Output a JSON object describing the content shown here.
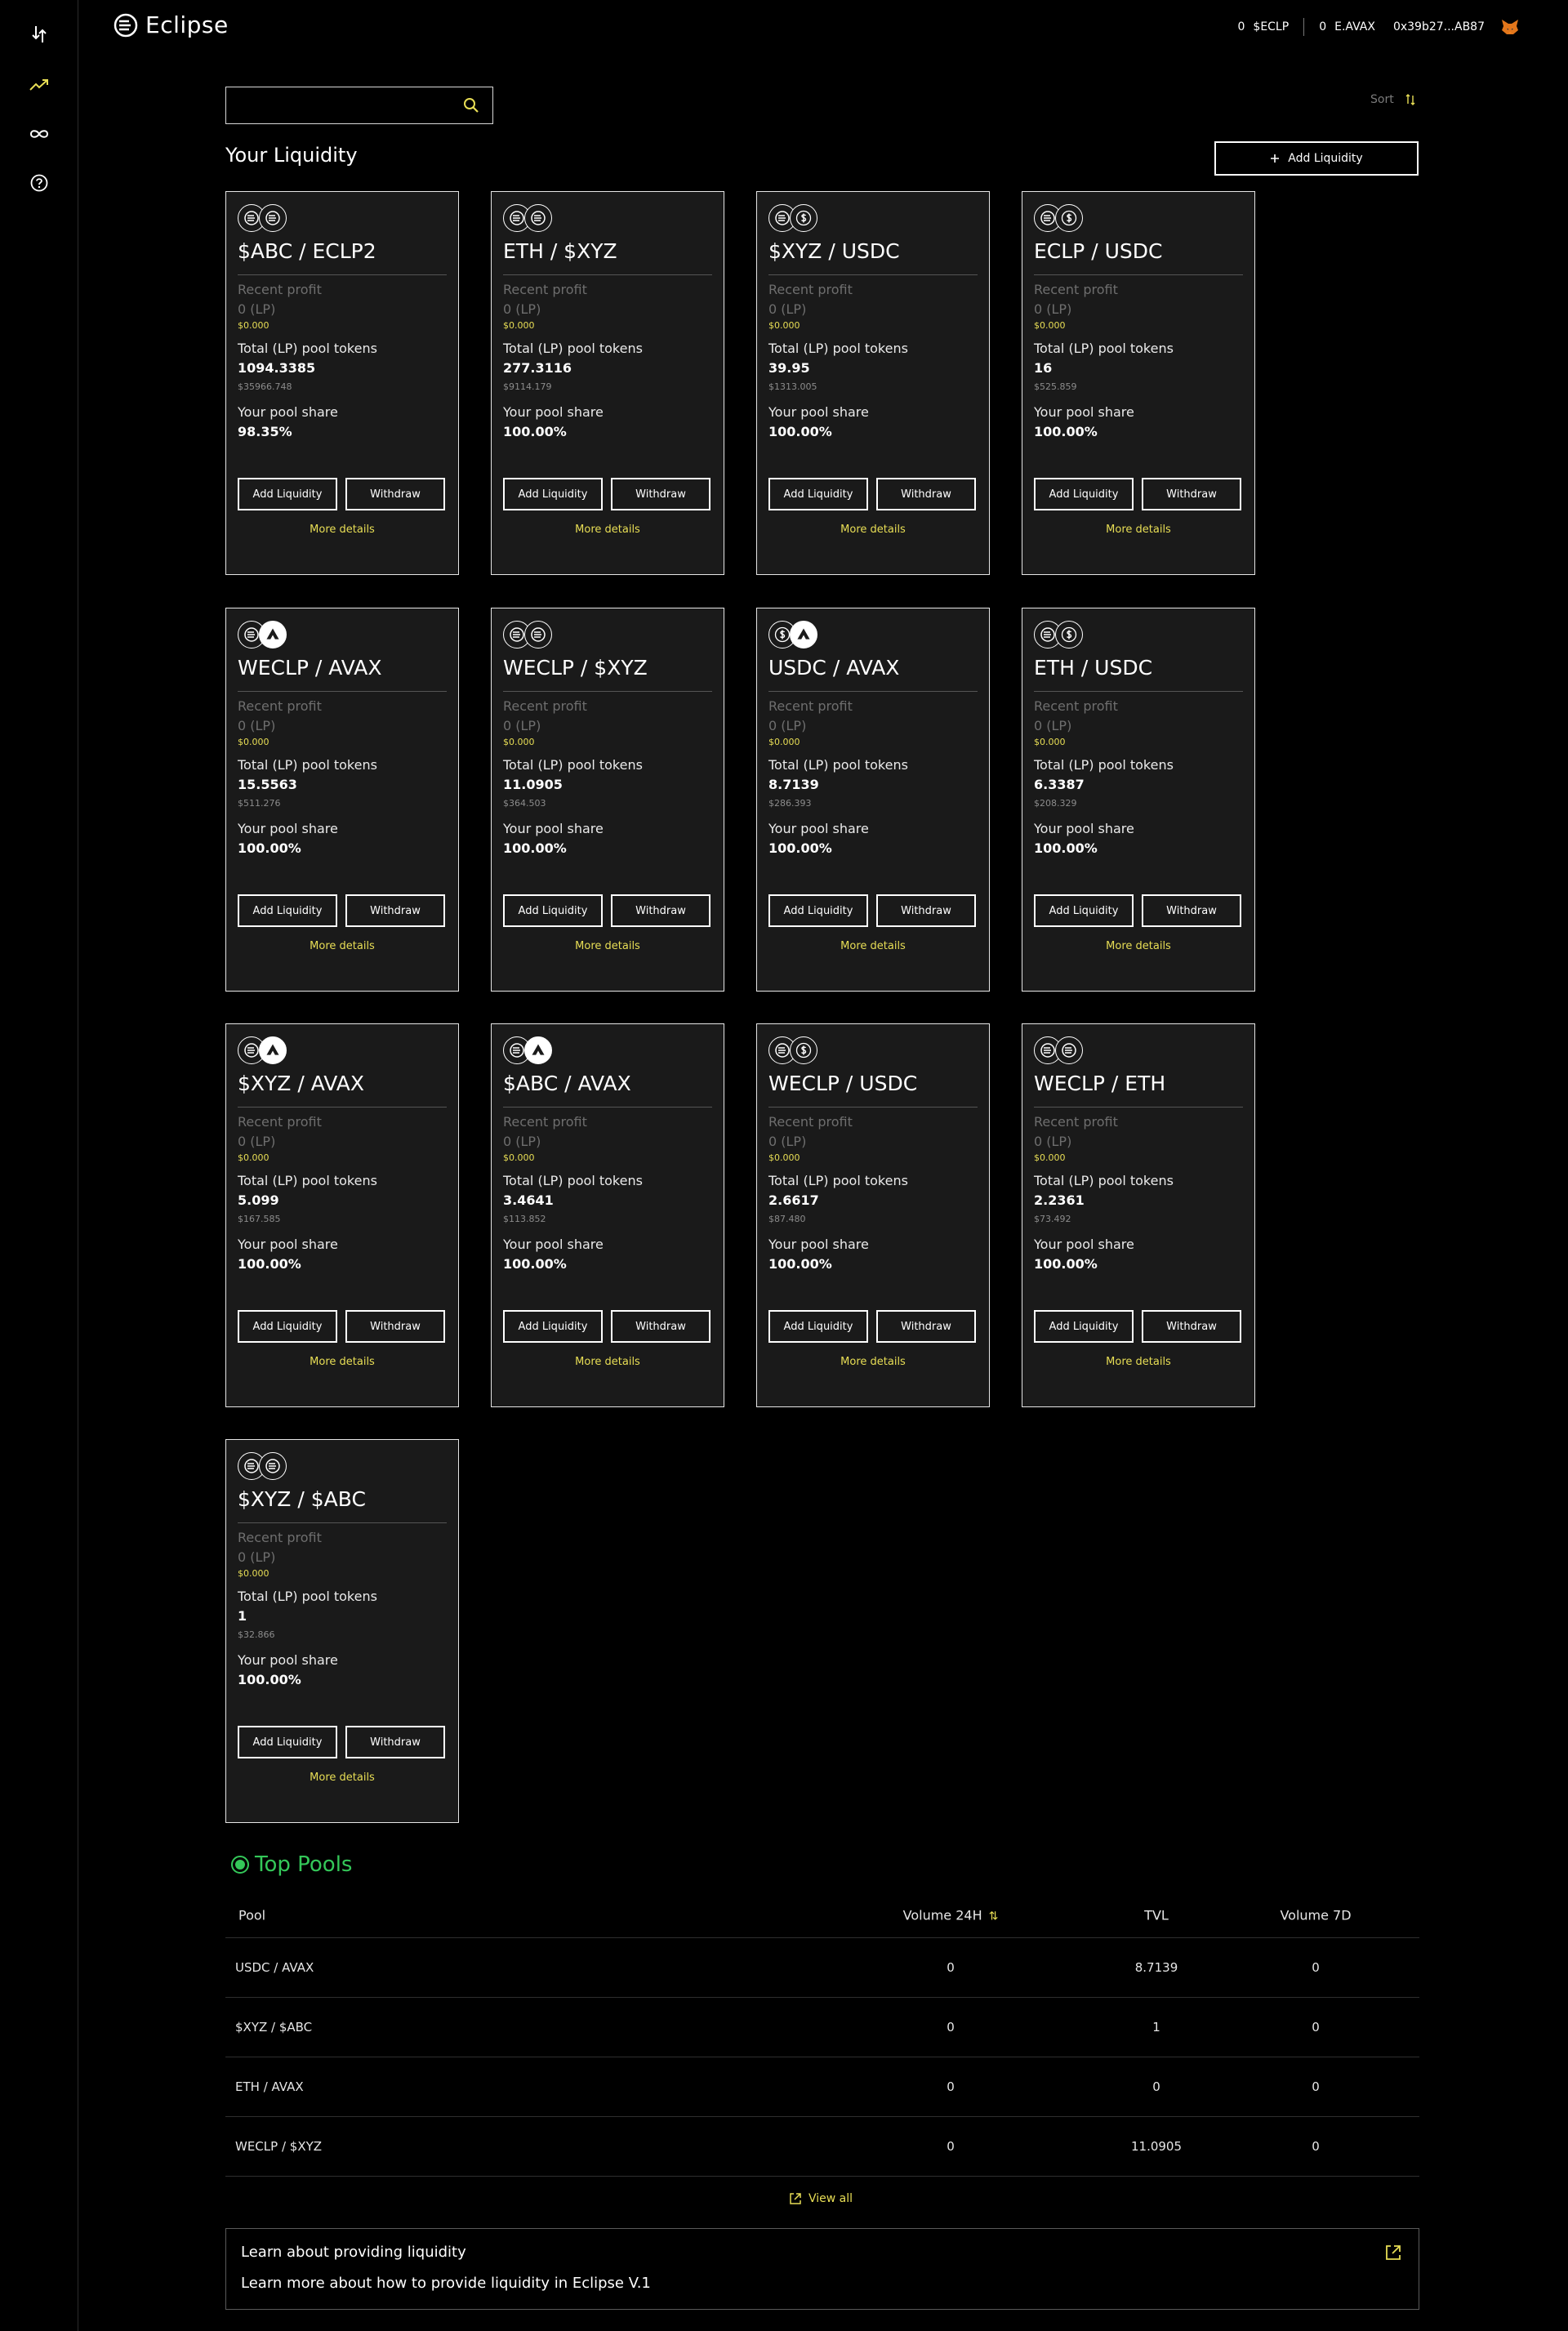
{
  "app": {
    "name": "Eclipse",
    "accent": "#e8de55",
    "green": "#34c759"
  },
  "header": {
    "balances": [
      {
        "amount": "0",
        "symbol": "$ECLP"
      },
      {
        "amount": "0",
        "symbol": "E.AVAX"
      }
    ],
    "wallet": "0x39b27...AB87",
    "wallet_icon": "metamask-fox-icon"
  },
  "sidebar": {
    "items": [
      {
        "icon": "swap-icon"
      },
      {
        "icon": "trending-up-icon"
      },
      {
        "icon": "infinity-icon"
      },
      {
        "icon": "help-icon"
      }
    ]
  },
  "search": {
    "value": "",
    "placeholder": ""
  },
  "sort": {
    "label": "Sort"
  },
  "liquidity": {
    "title": "Your Liquidity",
    "add_button": "Add Liquidity",
    "labels": {
      "recent_profit": "Recent profit",
      "total_tokens": "Total (LP) pool tokens",
      "pool_share": "Your pool share",
      "add": "Add Liquidity",
      "withdraw": "Withdraw",
      "more": "More details"
    },
    "cards": [
      {
        "title": "$ABC / ECLP2",
        "icons": [
          "eclipse-coin-icon",
          "eclipse-coin-icon"
        ],
        "profit_lp": "0 (LP)",
        "profit_usd": "$0.000",
        "tokens": "1094.3385",
        "tokens_usd": "$35966.748",
        "share": "98.35%"
      },
      {
        "title": "ETH / $XYZ",
        "icons": [
          "eclipse-coin-icon",
          "eclipse-coin-icon"
        ],
        "profit_lp": "0 (LP)",
        "profit_usd": "$0.000",
        "tokens": "277.3116",
        "tokens_usd": "$9114.179",
        "share": "100.00%"
      },
      {
        "title": "$XYZ / USDC",
        "icons": [
          "eclipse-coin-icon",
          "usdc-coin-icon"
        ],
        "profit_lp": "0 (LP)",
        "profit_usd": "$0.000",
        "tokens": "39.95",
        "tokens_usd": "$1313.005",
        "share": "100.00%"
      },
      {
        "title": "ECLP / USDC",
        "icons": [
          "eclipse-coin-icon",
          "usdc-coin-icon"
        ],
        "profit_lp": "0 (LP)",
        "profit_usd": "$0.000",
        "tokens": "16",
        "tokens_usd": "$525.859",
        "share": "100.00%"
      },
      {
        "title": "WECLP / AVAX",
        "icons": [
          "eclipse-coin-icon",
          "avax-coin-icon"
        ],
        "profit_lp": "0 (LP)",
        "profit_usd": "$0.000",
        "tokens": "15.5563",
        "tokens_usd": "$511.276",
        "share": "100.00%"
      },
      {
        "title": "WECLP / $XYZ",
        "icons": [
          "eclipse-coin-icon",
          "eclipse-coin-icon"
        ],
        "profit_lp": "0 (LP)",
        "profit_usd": "$0.000",
        "tokens": "11.0905",
        "tokens_usd": "$364.503",
        "share": "100.00%"
      },
      {
        "title": "USDC / AVAX",
        "icons": [
          "usdc-coin-icon",
          "avax-coin-icon"
        ],
        "profit_lp": "0 (LP)",
        "profit_usd": "$0.000",
        "tokens": "8.7139",
        "tokens_usd": "$286.393",
        "share": "100.00%"
      },
      {
        "title": "ETH / USDC",
        "icons": [
          "eclipse-coin-icon",
          "usdc-coin-icon"
        ],
        "profit_lp": "0 (LP)",
        "profit_usd": "$0.000",
        "tokens": "6.3387",
        "tokens_usd": "$208.329",
        "share": "100.00%"
      },
      {
        "title": "$XYZ / AVAX",
        "icons": [
          "eclipse-coin-icon",
          "avax-coin-icon"
        ],
        "profit_lp": "0 (LP)",
        "profit_usd": "$0.000",
        "tokens": "5.099",
        "tokens_usd": "$167.585",
        "share": "100.00%"
      },
      {
        "title": "$ABC / AVAX",
        "icons": [
          "eclipse-coin-icon",
          "avax-coin-icon"
        ],
        "profit_lp": "0 (LP)",
        "profit_usd": "$0.000",
        "tokens": "3.4641",
        "tokens_usd": "$113.852",
        "share": "100.00%"
      },
      {
        "title": "WECLP / USDC",
        "icons": [
          "eclipse-coin-icon",
          "usdc-coin-icon"
        ],
        "profit_lp": "0 (LP)",
        "profit_usd": "$0.000",
        "tokens": "2.6617",
        "tokens_usd": "$87.480",
        "share": "100.00%"
      },
      {
        "title": "WECLP / ETH",
        "icons": [
          "eclipse-coin-icon",
          "eclipse-coin-icon"
        ],
        "profit_lp": "0 (LP)",
        "profit_usd": "$0.000",
        "tokens": "2.2361",
        "tokens_usd": "$73.492",
        "share": "100.00%"
      },
      {
        "title": "$XYZ / $ABC",
        "icons": [
          "eclipse-coin-icon",
          "eclipse-coin-icon"
        ],
        "profit_lp": "0 (LP)",
        "profit_usd": "$0.000",
        "tokens": "1",
        "tokens_usd": "$32.866",
        "share": "100.00%"
      }
    ]
  },
  "top_pools": {
    "title": "Top Pools",
    "columns": {
      "pool": "Pool",
      "vol24": "Volume 24H",
      "tvl": "TVL",
      "vol7": "Volume 7D"
    },
    "rows": [
      {
        "pool": "USDC / AVAX",
        "vol24": "0",
        "tvl": "8.7139",
        "vol7": "0"
      },
      {
        "pool": "$XYZ / $ABC",
        "vol24": "0",
        "tvl": "1",
        "vol7": "0"
      },
      {
        "pool": "ETH / AVAX",
        "vol24": "0",
        "tvl": "0",
        "vol7": "0"
      },
      {
        "pool": "WECLP / $XYZ",
        "vol24": "0",
        "tvl": "11.0905",
        "vol7": "0"
      }
    ],
    "view_all": "View all"
  },
  "learn": {
    "line1": "Learn about providing liquidity",
    "line2": "Learn more about how to provide liquidity in Eclipse V.1"
  }
}
